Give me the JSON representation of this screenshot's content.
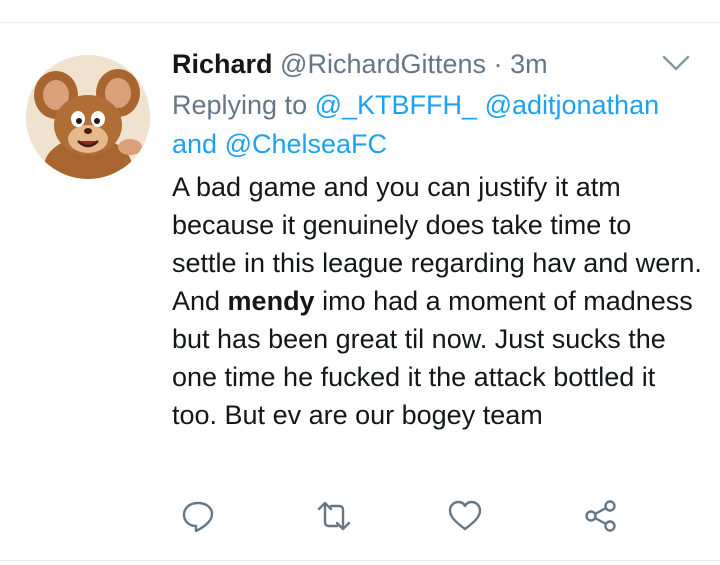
{
  "tweet": {
    "display_name": "Richard",
    "handle": "@RichardGittens",
    "separator": "·",
    "timestamp": "3m",
    "replying_prefix": "Replying to",
    "mention_1": "@_KTBFFH_",
    "mention_2": "@aditjonathan",
    "conjunction": "and",
    "mention_3": "@ChelseaFC",
    "text_part_1": "A bad game and you can justify it atm because it genuinely does take time to settle in this league regarding hav and wern. And ",
    "text_bold": "mendy",
    "text_part_2": " imo had a moment of madness but has been great til now. Just sucks the one time he fucked it the attack bottled it too. But ev are our bogey team"
  },
  "actions": [
    "reply-icon",
    "retweet-icon",
    "like-icon",
    "share-icon"
  ],
  "colors": {
    "text": "#14171a",
    "muted": "#657786",
    "link": "#1da1f2",
    "divider": "#e6ecf0"
  }
}
